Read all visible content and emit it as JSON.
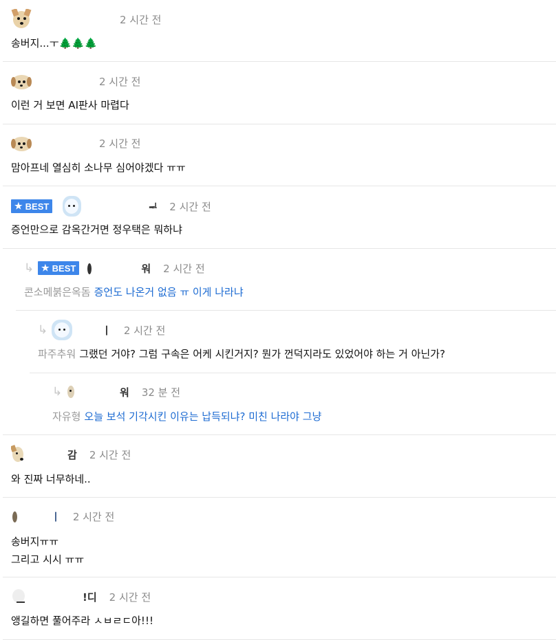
{
  "comments": [
    {
      "time": "2 시간 전",
      "nick": "",
      "text": "송버지...ㅜ🌲🌲🌲"
    },
    {
      "time": "2 시간 전",
      "nick": "",
      "text": "이런 거 보면 AI판사 마렵다"
    },
    {
      "time": "2 시간 전",
      "nick": "",
      "text": "맘아프네 열심히 소나무 심어야겠다 ㅠㅠ"
    },
    {
      "badge": "BEST",
      "time": "2 시간 전",
      "nick": "ᆗ",
      "text": "증언만으로 감옥간거면 정우택은 뭐하냐"
    },
    {
      "badge": "BEST",
      "time": "2 시간 전",
      "nick": "워",
      "ref": "콘소메붉은옥돔",
      "text": "증언도 나온거 없음 ㅠ 이게 나라냐"
    },
    {
      "time": "2 시간 전",
      "nick": "ㅣ",
      "ref": "파주추워",
      "text": "그랬던 거야? 그럼 구속은 어케 시킨거지? 뭔가 껀덕지라도 있었어야 하는 거 아닌가?"
    },
    {
      "time": "32 분 전",
      "nick": "워",
      "ref": "자유형",
      "text": "오늘 보석 기각시킨 이유는 납득되냐? 미친 나라야 그냥"
    },
    {
      "time": "2 시간 전",
      "nick": "감",
      "text": "와 진짜 너무하네.."
    },
    {
      "time": "2 시간 전",
      "nick": "ㅣ",
      "text_line1": "송버지ㅠㅠ",
      "text_line2": "그리고 시시 ㅠㅠ"
    },
    {
      "time": "2 시간 전",
      "nick": "!디",
      "text": "앵길하면 풀어주라 ㅅㅂㄹㄷ아!!!"
    }
  ],
  "icons": {
    "reply": "reply-arrow-icon",
    "star": "star-icon"
  },
  "colors": {
    "badge_bg": "#3d86ea",
    "link": "#1b6ad2",
    "muted": "#8a8a8a"
  }
}
